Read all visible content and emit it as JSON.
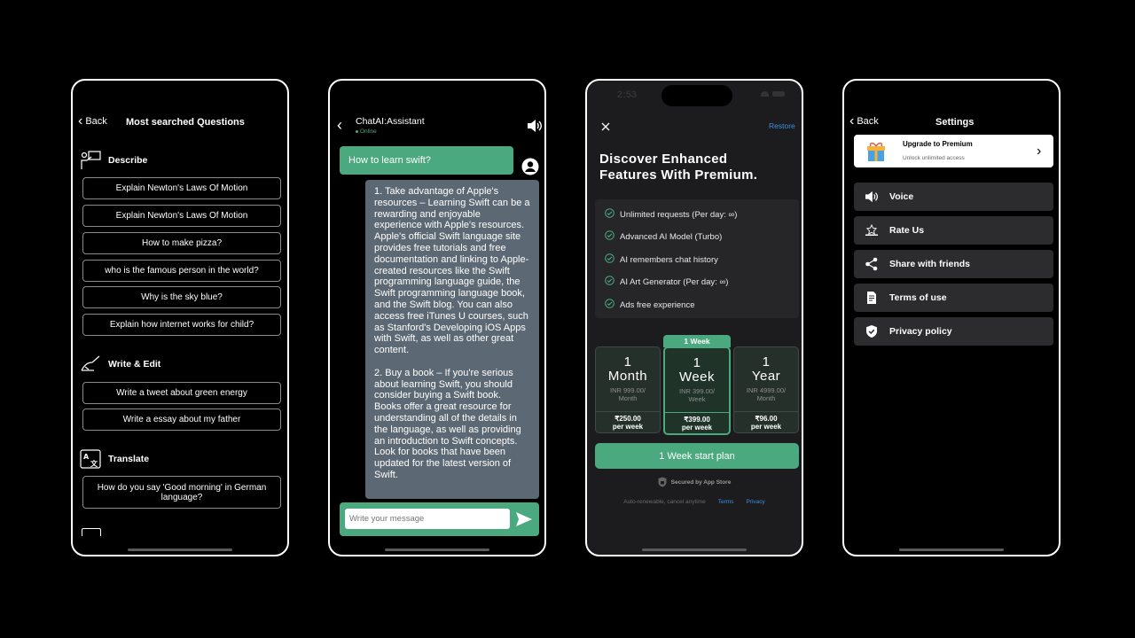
{
  "screen1": {
    "back_label": "Back",
    "title": "Most searched Questions",
    "sections": [
      {
        "title": "Describe",
        "icon": "teacher-board-icon",
        "questions": [
          "Explain Newton's Laws Of Motion",
          "Explain Newton's Laws Of Motion",
          "How to make pizza?",
          "who is the famous person in the world?",
          "Why is the sky blue?",
          "Explain how internet works for child?"
        ]
      },
      {
        "title": "Write & Edit",
        "icon": "writing-hand-icon",
        "questions": [
          "Write a tweet about green energy",
          "Write a essay about my father"
        ]
      },
      {
        "title": "Translate",
        "icon": "translate-icon",
        "questions": [
          "How do you say 'Good morning' in German language?"
        ]
      }
    ]
  },
  "screen2": {
    "title": "ChatAI:Assistant",
    "status": "Online",
    "user_message": "How to learn swift?",
    "bot_paragraph_1": "1. Take advantage of Apple's resources – Learning Swift can be a rewarding and enjoyable experience with Apple's resources. Apple's official Swift language site provides free tutorials and free documentation and linking to Apple-created resources like the Swift programming language guide, the Swift programming language book, and the Swift blog. You can also access free iTunes U courses, such as Stanford's Developing iOS Apps with Swift, as well as other great content.",
    "bot_paragraph_2": "2. Buy a book – If you're serious about learning Swift, you should consider buying a Swift book. Books offer a great resource for understanding all of the details in the language, as well as providing an introduction to Swift concepts. Look for books that have been updated for the latest version of Swift.",
    "input_placeholder": "Write your message"
  },
  "screen3": {
    "status_time": "2:53",
    "restore_label": "Restore",
    "heading": "Discover Enhanced Features With Premium.",
    "features": [
      "Unlimited requests (Per day: ∞)",
      "Advanced AI Model (Turbo)",
      "AI remembers chat history",
      "AI Art Generator (Per day: ∞)",
      "Ads free experience"
    ],
    "plans": [
      {
        "num": "1",
        "unit": "Month",
        "sub1": "INR 999.00/",
        "sub2": "Month",
        "price": "₹250.00",
        "per": "per week",
        "badge": ""
      },
      {
        "num": "1",
        "unit": "Week",
        "sub1": "INR 399.00/",
        "sub2": "Week",
        "price": "₹399.00",
        "per": "per week",
        "badge": "1 Week"
      },
      {
        "num": "1",
        "unit": "Year",
        "sub1": "INR 4999.00/",
        "sub2": "Month",
        "price": "₹96.00",
        "per": "per week",
        "badge": ""
      }
    ],
    "start_button": "1 Week start plan",
    "secured": "Secured by App Store",
    "footer_note": "Auto-renewable, cancel anytime",
    "terms": "Terms",
    "privacy": "Privacy",
    "accent": "#4aa97e"
  },
  "screen4": {
    "back_label": "Back",
    "title": "Settings",
    "premium_title": "Upgrade to Premium",
    "premium_sub": "Unlock unlimited access",
    "items": [
      {
        "label": "Voice",
        "icon": "speaker-icon"
      },
      {
        "label": "Rate Us",
        "icon": "rate-star-icon"
      },
      {
        "label": "Share with friends",
        "icon": "share-icon"
      },
      {
        "label": "Terms of use",
        "icon": "document-icon"
      },
      {
        "label": "Privacy policy",
        "icon": "shield-check-icon"
      }
    ]
  }
}
